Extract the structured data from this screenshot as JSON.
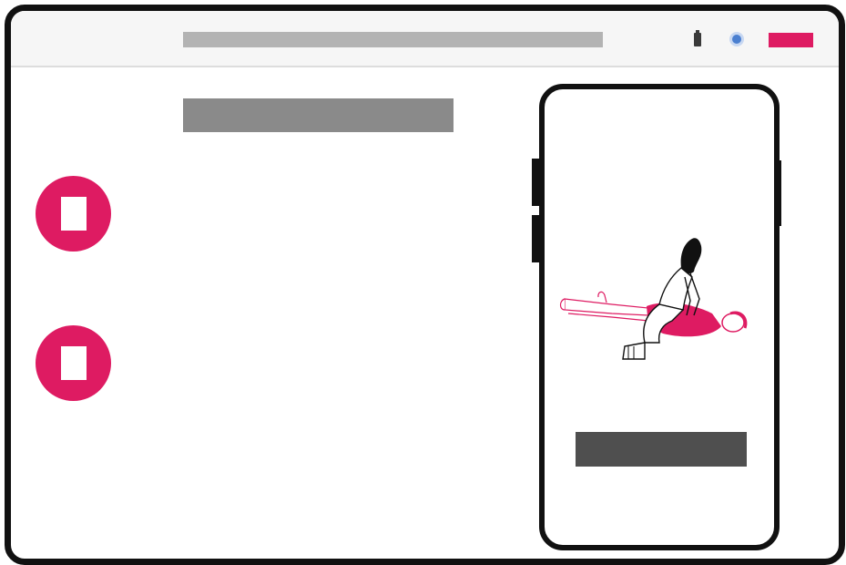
{
  "window": {
    "topbar": {
      "address_bar": "",
      "icons": [
        "battery-icon",
        "status-dot-icon"
      ],
      "action_button_label": ""
    },
    "main": {
      "heading": "",
      "list_items": [
        {
          "icon": "document-icon",
          "label": ""
        },
        {
          "icon": "document-icon",
          "label": ""
        }
      ]
    },
    "phone": {
      "illustration": "cpr-illustration",
      "button_label": ""
    }
  },
  "colors": {
    "accent": "#de1b62",
    "frame": "#111111",
    "topbar_bg": "#f6f6f6",
    "placeholder_light": "#b3b3b3",
    "placeholder_mid": "#8a8a8a",
    "placeholder_dark": "#4f4f4f",
    "status_dot": "#4a7fd0"
  }
}
